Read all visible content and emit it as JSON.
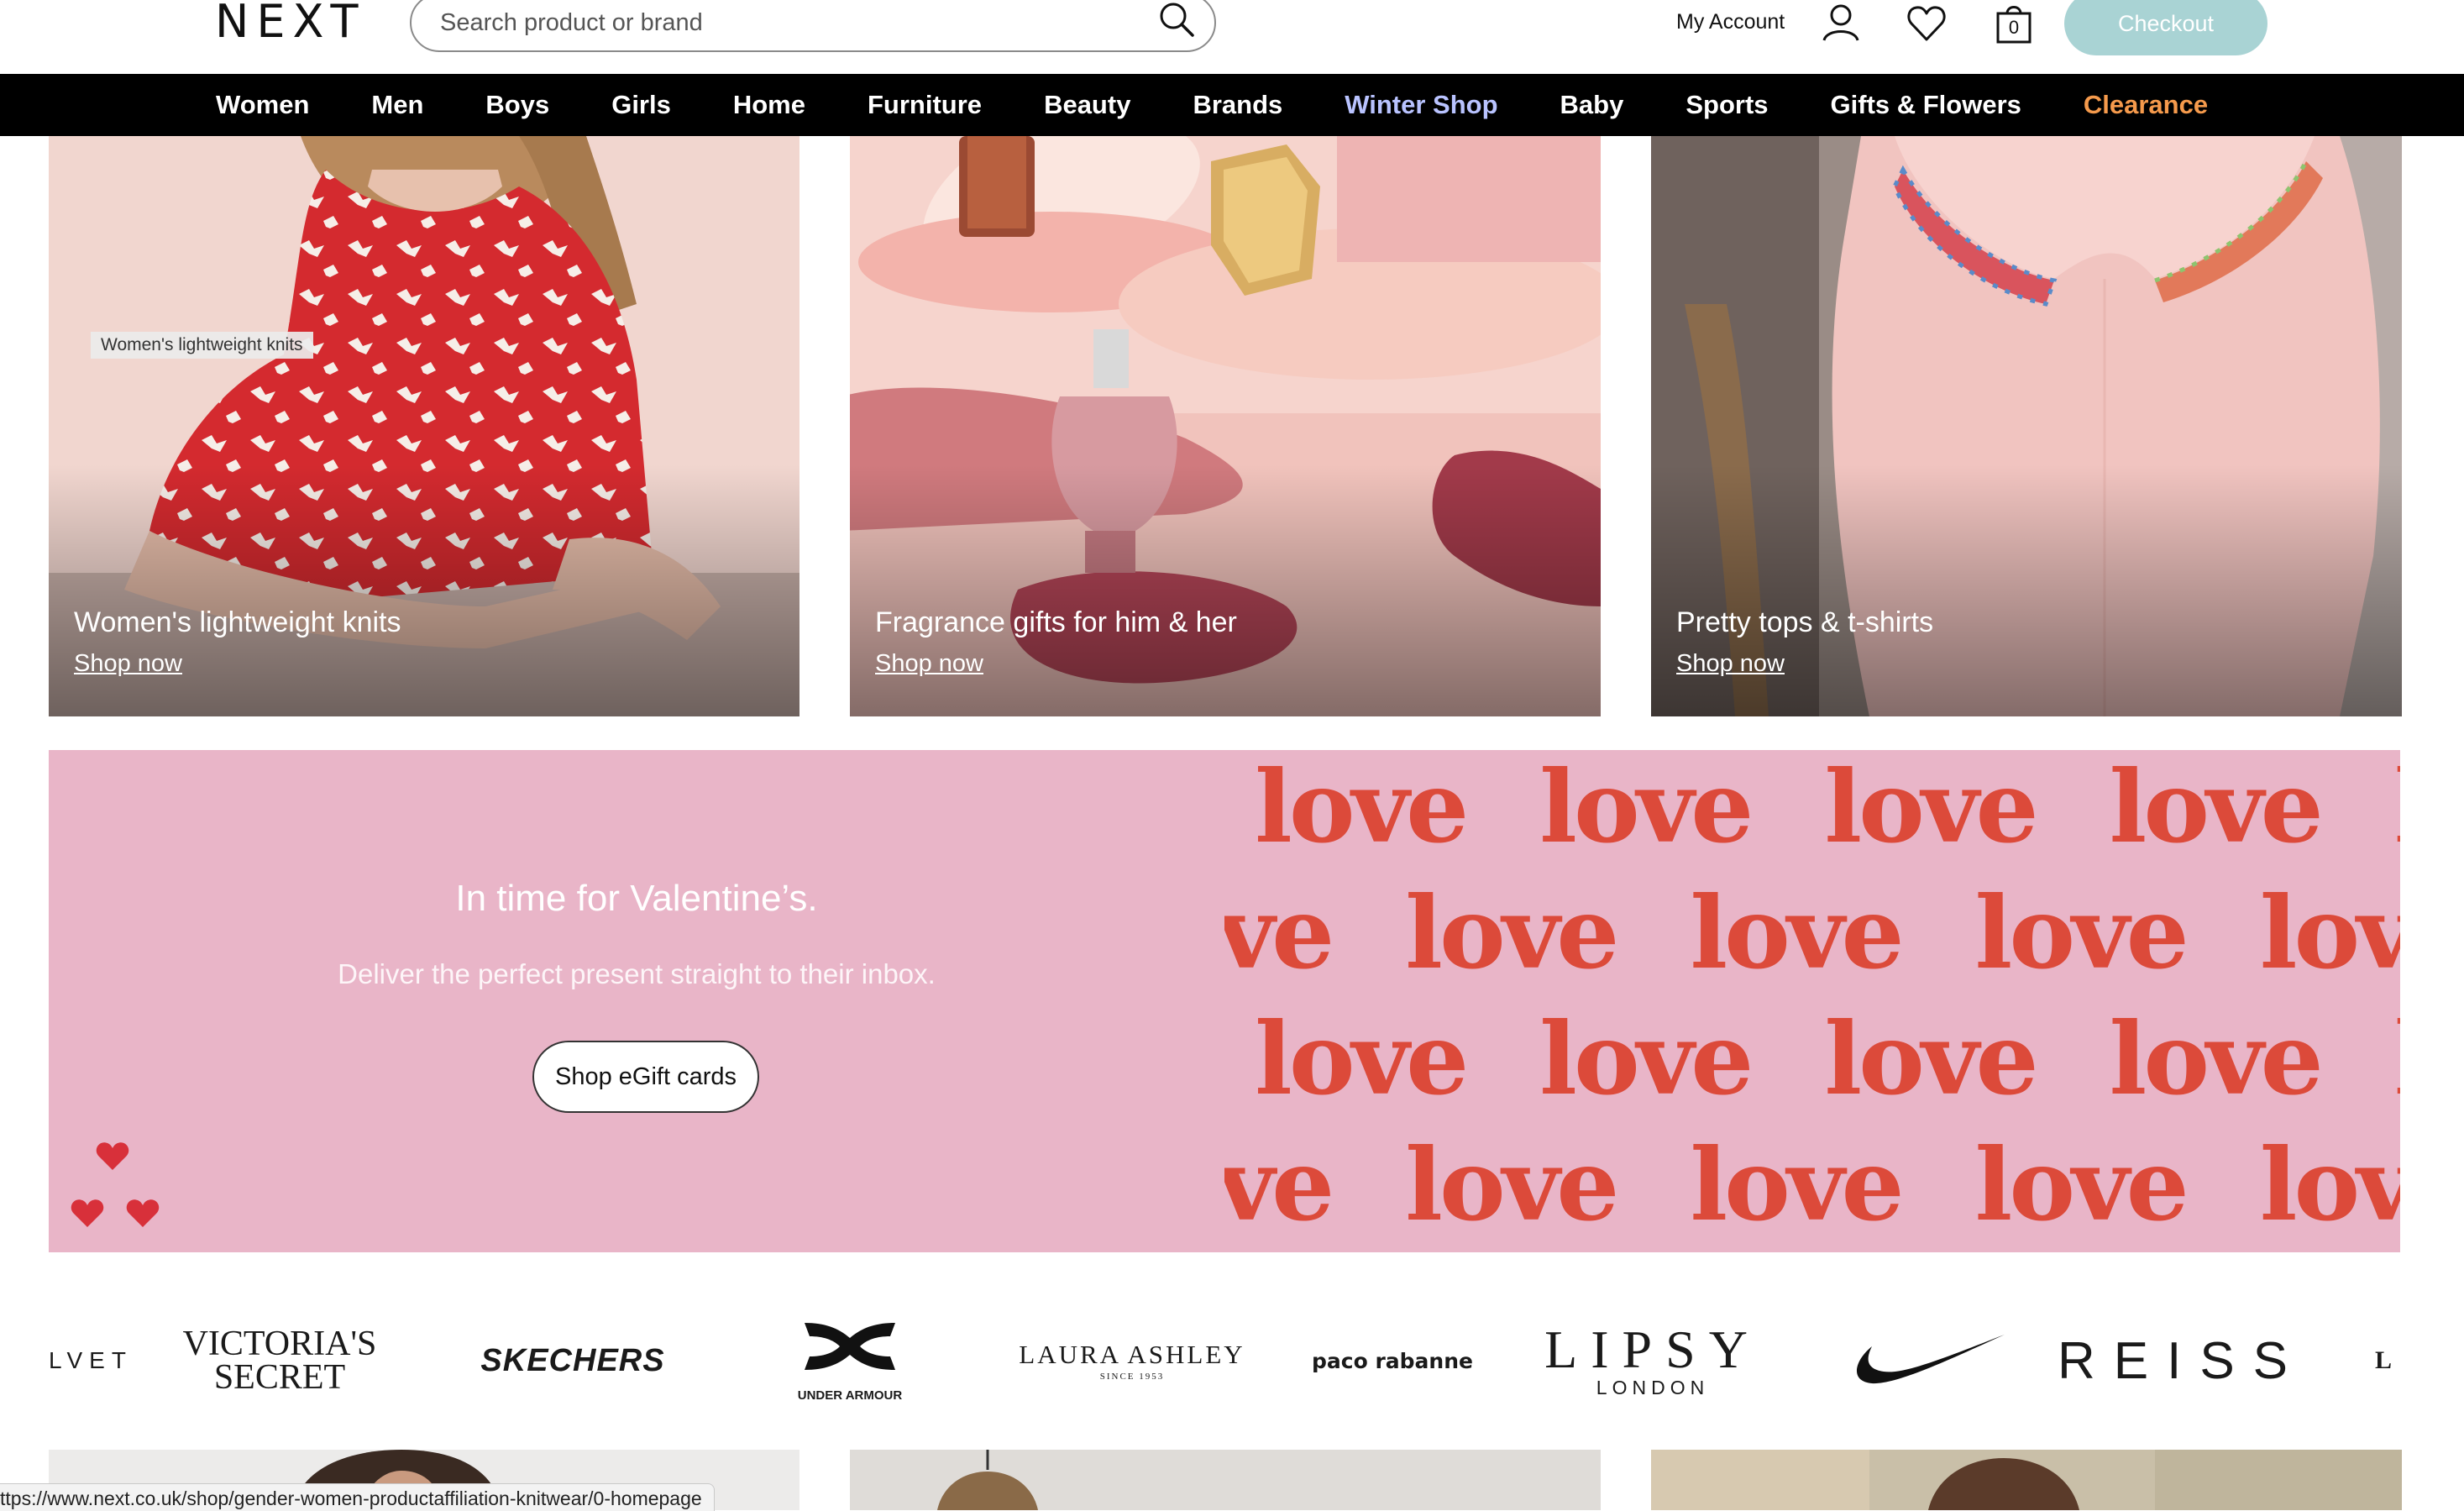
{
  "header": {
    "logo": "NEXT",
    "search_placeholder": "Search product or brand",
    "account_label": "My Account",
    "bag_count": "0",
    "checkout_label": "Checkout"
  },
  "nav": {
    "items": [
      "Women",
      "Men",
      "Boys",
      "Girls",
      "Home",
      "Furniture",
      "Beauty",
      "Brands",
      "Winter Shop",
      "Baby",
      "Sports",
      "Gifts & Flowers",
      "Clearance"
    ],
    "colors": {
      "default": "#ffffff",
      "winter_shop": "#b9c3ff",
      "clearance": "#f59a4c"
    }
  },
  "tiles": [
    {
      "title": "Women's lightweight knits",
      "cta": "Shop now",
      "tag": "Women's lightweight knits"
    },
    {
      "title": "Fragrance gifts for him & her",
      "cta": "Shop now"
    },
    {
      "title": "Pretty tops & t-shirts",
      "cta": "Shop now"
    }
  ],
  "banner": {
    "title": "In time for Valentine’s.",
    "subtitle": "Deliver the perfect present straight to their inbox.",
    "button": "Shop eGift cards",
    "pattern_word": "love",
    "background": "#e9b5c8",
    "pattern_color": "#dc4a3a"
  },
  "brands": {
    "velvet_partial": "LVET",
    "victorias_secret_1": "VICTORIA'S",
    "victorias_secret_2": "SECRET",
    "skechers": "SKECHERS",
    "under_armour": "UNDER ARMOUR",
    "laura_ashley": "LAURA ASHLEY",
    "laura_ashley_since": "SINCE 1953",
    "paco_rabanne": "paco rabanne",
    "lipsy": "LIPSY",
    "lipsy_city": "LONDON",
    "nike_icon": "nike-swoosh-icon",
    "reiss": "REISS",
    "partial_next": "L"
  },
  "status_url": "ttps://www.next.co.uk/shop/gender-women-productaffiliation-knitwear/0-homepage"
}
